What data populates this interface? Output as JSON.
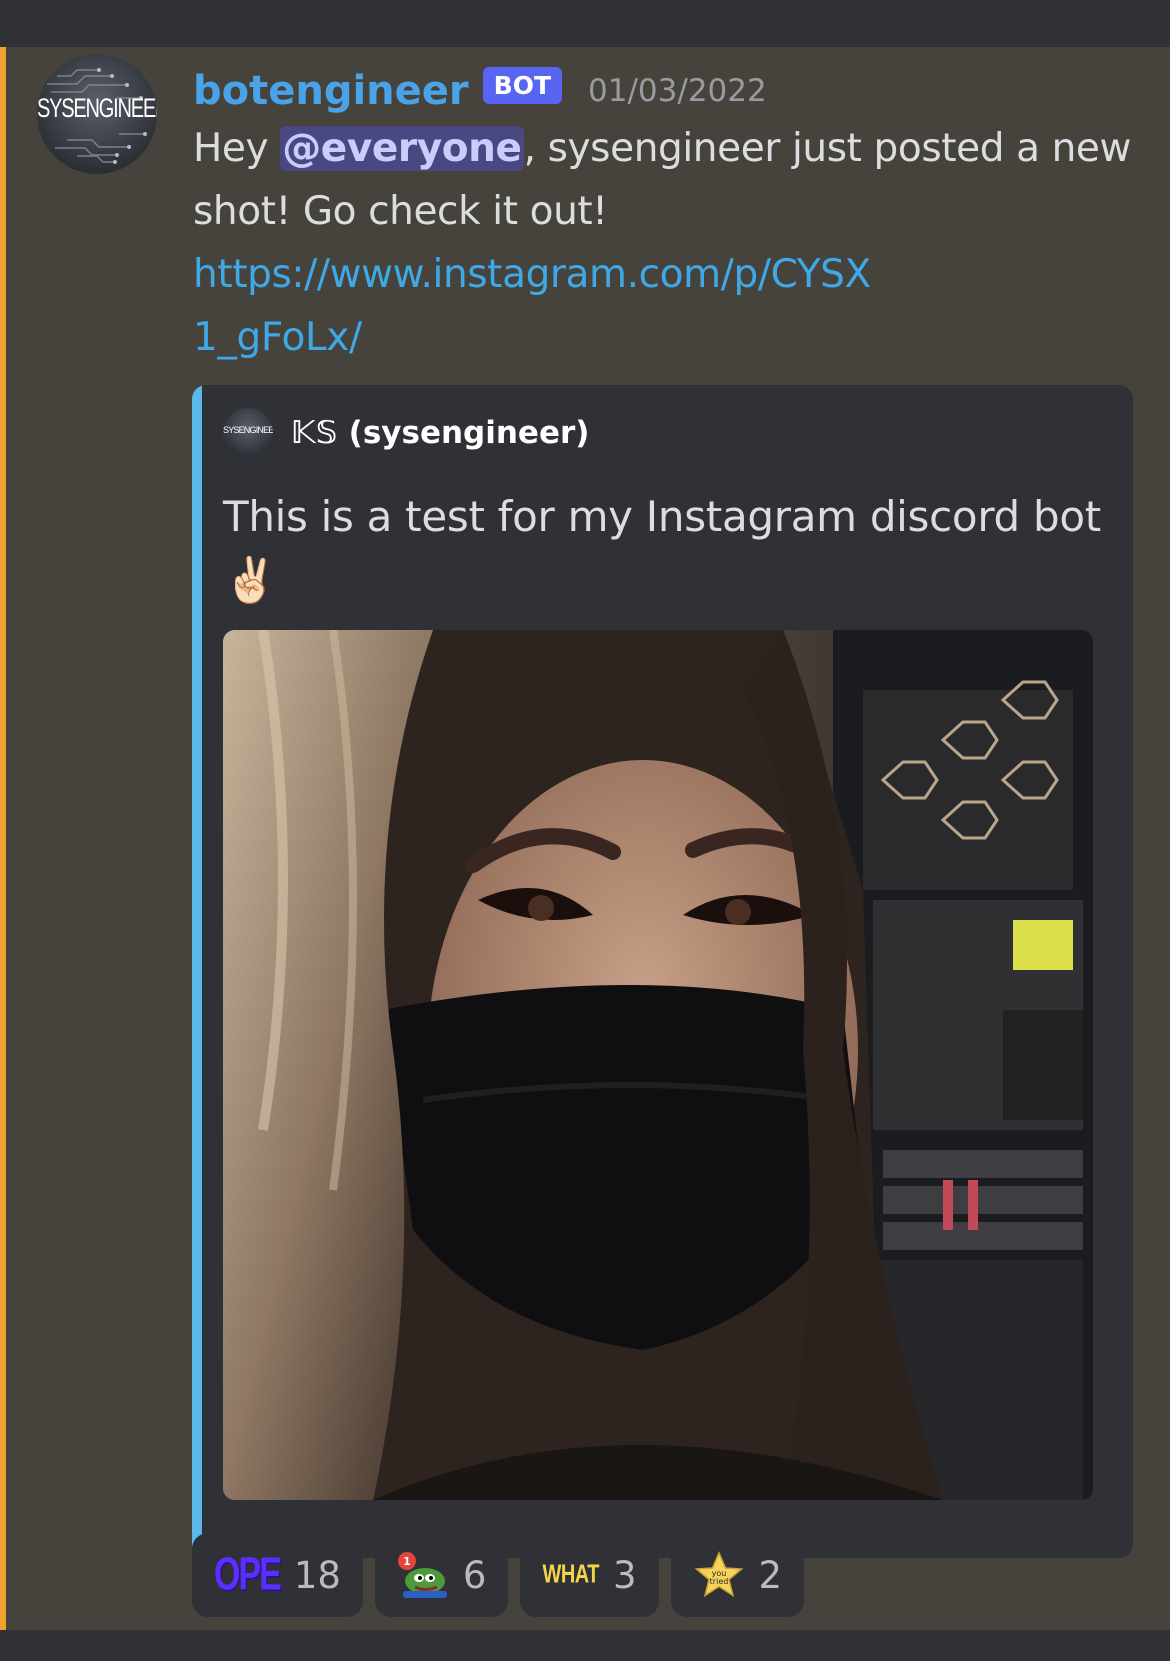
{
  "message": {
    "username": "botengineer",
    "bot_tag": "BOT",
    "timestamp": "01/03/2022",
    "avatar_text": "SYSENGINEER",
    "text_before_mention": "Hey ",
    "mention": "@everyone",
    "text_after_mention": ", sysengineer just posted a new shot! Go check it out!",
    "link": "https://www.instagram.com/p/CYSX1_gFoLx/"
  },
  "embed": {
    "author_icon_text": "SYSENGINEER",
    "author_name": "𝕂𝕊 (sysengineer)",
    "description": "This is a test for my Instagram discord bot",
    "description_emoji": "✌🏻",
    "accent_color": "#5bb9ea"
  },
  "reactions": [
    {
      "emoji_name": "ope-emoji",
      "emoji_text": "OPE",
      "count": "18"
    },
    {
      "emoji_name": "pepe-notification-emoji",
      "emoji_text": "",
      "count": "6"
    },
    {
      "emoji_name": "what-emoji",
      "emoji_text": "WHAT",
      "count": "3"
    },
    {
      "emoji_name": "you-tried-star-emoji",
      "emoji_text": "you tried",
      "count": "2"
    }
  ],
  "colors": {
    "mention_bar": "#f0a32f",
    "username": "#4aa3e8",
    "bot_tag": "#5865f2",
    "link": "#3fa8e6"
  }
}
